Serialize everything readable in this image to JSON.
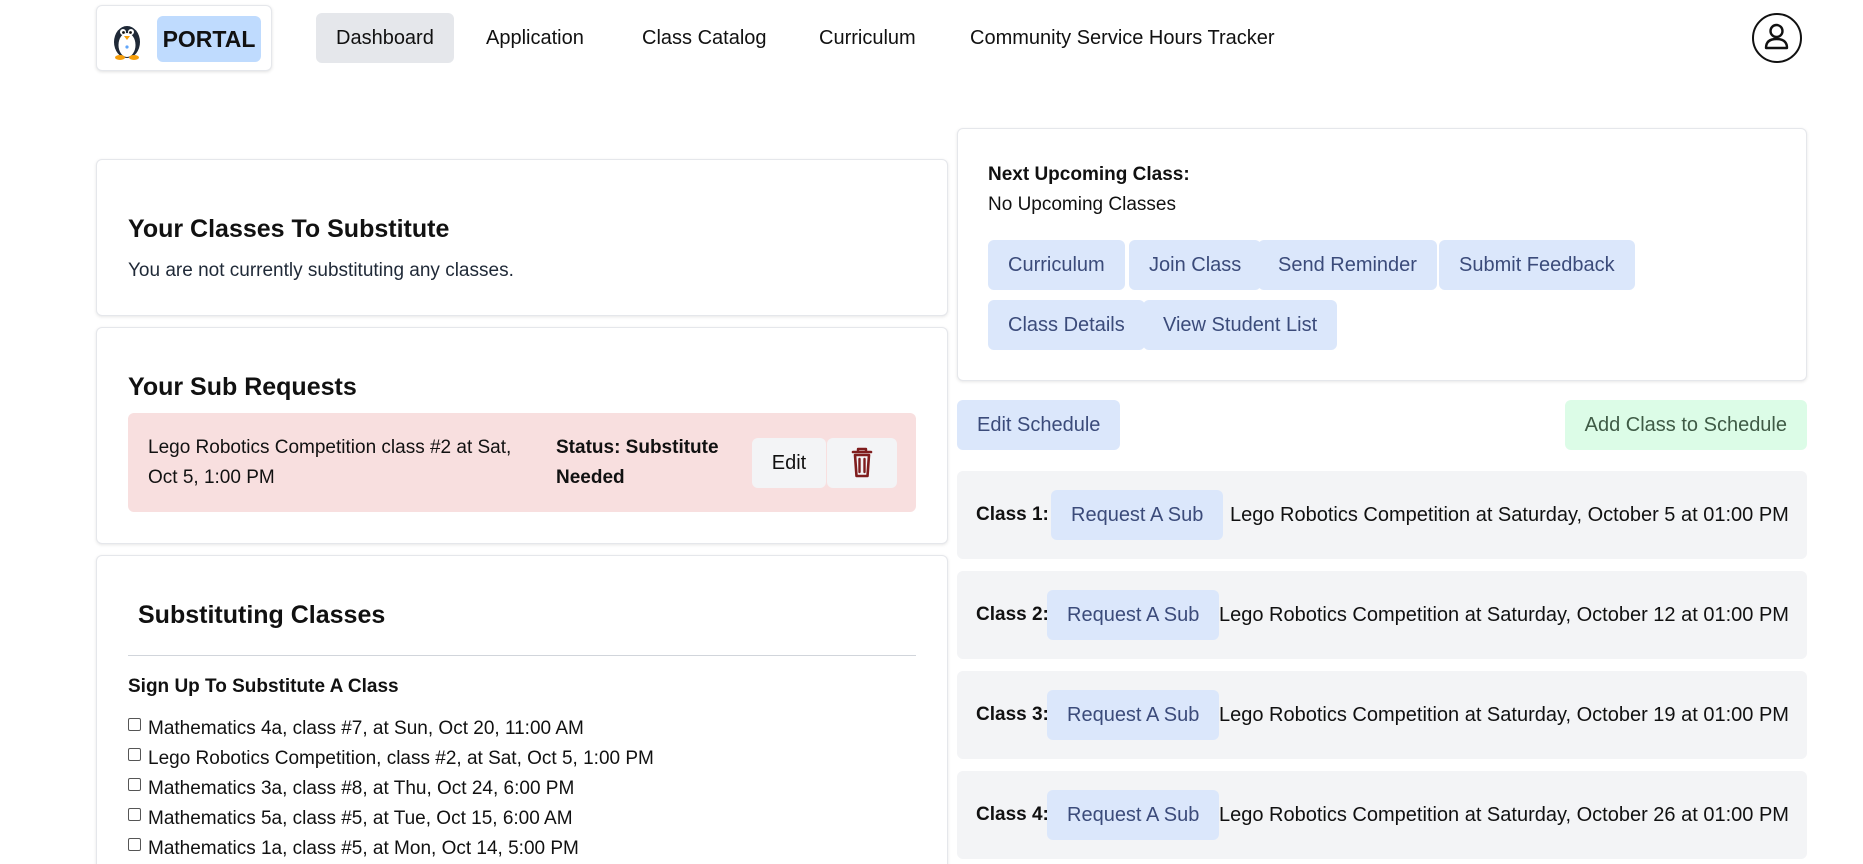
{
  "header": {
    "brand": "PORTAL",
    "nav": [
      {
        "label": "Dashboard",
        "active": true
      },
      {
        "label": "Application",
        "active": false
      },
      {
        "label": "Class Catalog",
        "active": false
      },
      {
        "label": "Curriculum",
        "active": false
      },
      {
        "label": "Community Service Hours Tracker",
        "active": false
      }
    ]
  },
  "classes_to_substitute": {
    "title": "Your Classes To Substitute",
    "empty_text": "You are not currently substituting any classes."
  },
  "sub_requests": {
    "title": "Your Sub Requests",
    "items": [
      {
        "text": "Lego Robotics Competition class #2 at Sat, Oct 5, 1:00 PM",
        "status": "Status: Substitute Needed",
        "edit_label": "Edit"
      }
    ]
  },
  "substituting_classes": {
    "title": "Substituting Classes",
    "signup_title": "Sign Up To Substitute A Class",
    "options": [
      "Mathematics 4a, class #7, at Sun, Oct 20, 11:00 AM",
      "Lego Robotics Competition, class #2, at Sat, Oct 5, 1:00 PM",
      "Mathematics 3a, class #8, at Thu, Oct 24, 6:00 PM",
      "Mathematics 5a, class #5, at Tue, Oct 15, 6:00 AM",
      "Mathematics 1a, class #5, at Mon, Oct 14, 5:00 PM"
    ]
  },
  "upcoming": {
    "label": "Next Upcoming Class:",
    "value": "No Upcoming Classes",
    "buttons": {
      "curriculum": "Curriculum",
      "join": "Join Class",
      "reminder": "Send Reminder",
      "feedback": "Submit Feedback",
      "details": "Class Details",
      "students": "View Student List"
    }
  },
  "schedule": {
    "edit_label": "Edit Schedule",
    "add_label": "Add Class to Schedule",
    "request_label": "Request A Sub",
    "classes": [
      {
        "label": "Class 1:",
        "desc": "Lego Robotics Competition at Saturday, October 5 at 01:00 PM"
      },
      {
        "label": "Class 2:",
        "desc": "Lego Robotics Competition at Saturday, October 12 at 01:00 PM"
      },
      {
        "label": "Class 3:",
        "desc": "Lego Robotics Competition at Saturday, October 19 at 01:00 PM"
      },
      {
        "label": "Class 4:",
        "desc": "Lego Robotics Competition at Saturday, October 26 at 01:00 PM"
      }
    ]
  },
  "colors": {
    "nav_active": "#e5e7eb",
    "brand_bg": "#bfdbfe",
    "button_blue": "#dbe7fb",
    "button_green": "#dcfce7",
    "sub_request_bg": "#f8dfdf",
    "trash_icon": "#7f1d1d"
  },
  "icons": [
    "penguin-logo-icon",
    "trash-icon",
    "user-avatar-icon"
  ]
}
